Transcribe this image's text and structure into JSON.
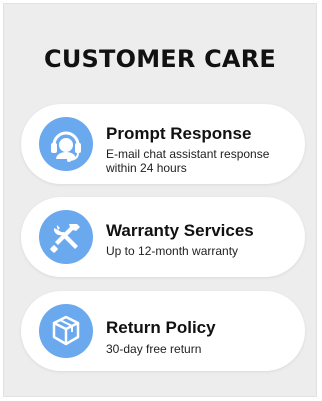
{
  "title": "CUSTOMER CARE",
  "cards": [
    {
      "title": "Prompt Response",
      "desc": "E-mail chat assistant response within 24 hours",
      "icon": "headset-icon"
    },
    {
      "title": "Warranty Services",
      "desc": "Up to 12-month warranty",
      "icon": "tools-icon"
    },
    {
      "title": "Return Policy",
      "desc": "30-day free return",
      "icon": "box-icon"
    }
  ],
  "colors": {
    "background": "#ededed",
    "card": "#ffffff",
    "icon_circle": "#6aa9ee",
    "text": "#111111"
  }
}
